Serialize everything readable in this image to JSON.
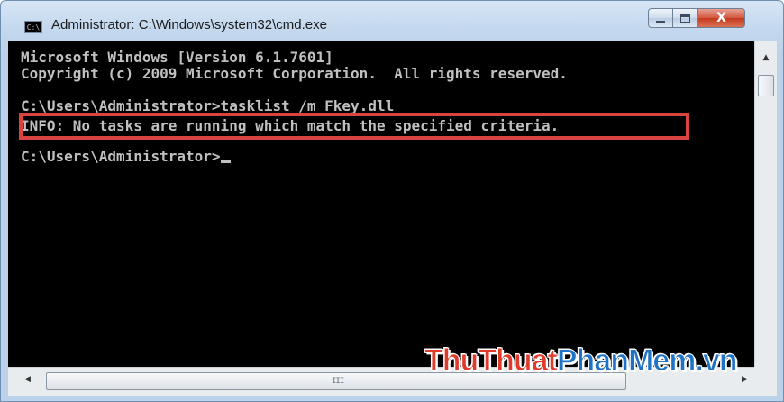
{
  "window": {
    "title": "Administrator: C:\\Windows\\system32\\cmd.exe",
    "icon": "cmd-icon",
    "icon_glyph": "C:\\",
    "controls": {
      "minimize_icon": "minimize-icon",
      "maximize_icon": "maximize-icon",
      "close_glyph": "X"
    }
  },
  "console": {
    "lines": [
      "Microsoft Windows [Version 6.1.7601]",
      "Copyright (c) 2009 Microsoft Corporation.  All rights reserved.",
      "",
      "C:\\Users\\Administrator>tasklist /m Fkey.dll",
      "INFO: No tasks are running which match the specified criteria.",
      "",
      "C:\\Users\\Administrator>"
    ],
    "background_color": "#000000",
    "text_color": "#c0c0c0",
    "highlight_color": "#d9453e"
  },
  "scrollbars": {
    "vertical_up_arrow": "▲",
    "horizontal_left_arrow": "◀",
    "horizontal_right_arrow": "▶",
    "grip_glyph": "III"
  },
  "watermark": {
    "part1": "ThuThuat",
    "part2": "PhanMem",
    "part3": ".vn"
  }
}
